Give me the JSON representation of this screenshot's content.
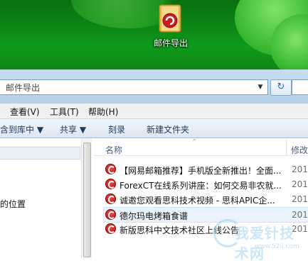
{
  "desktop": {
    "folder_label": "邮件导出"
  },
  "address_bar": {
    "path": "邮件导出",
    "dropdown_glyph": "▼",
    "refresh_glyph": "↻"
  },
  "menu": {
    "items": [
      "查看(V)",
      "工具(T)",
      "帮助(H)"
    ]
  },
  "toolbar": {
    "library_label": "含到库中 ▼",
    "share_label": "共享 ▼",
    "burn_label": "刻录",
    "new_folder_label": "新建文件夹"
  },
  "nav_pane": {
    "item_label": "的位置"
  },
  "file_list": {
    "col_name": "名称",
    "col_modified": "修改",
    "sort_glyph": "^",
    "rows": [
      {
        "name": "【网易邮箱推荐】手机版全新推出！全面...",
        "date": "201"
      },
      {
        "name": "ForexCT在线系列讲座：如何交易非农就...",
        "date": "201"
      },
      {
        "name": "诚邀您观看思科技术视频 - 思科APIC企...",
        "date": "201"
      },
      {
        "name": "德尔玛电烤箱食谱",
        "date": "201"
      },
      {
        "name": "新版思科中文技术社区上线公告",
        "date": "201"
      }
    ]
  },
  "watermark": {
    "text": "我爱针技术网",
    "url": "www.52ij.com"
  }
}
